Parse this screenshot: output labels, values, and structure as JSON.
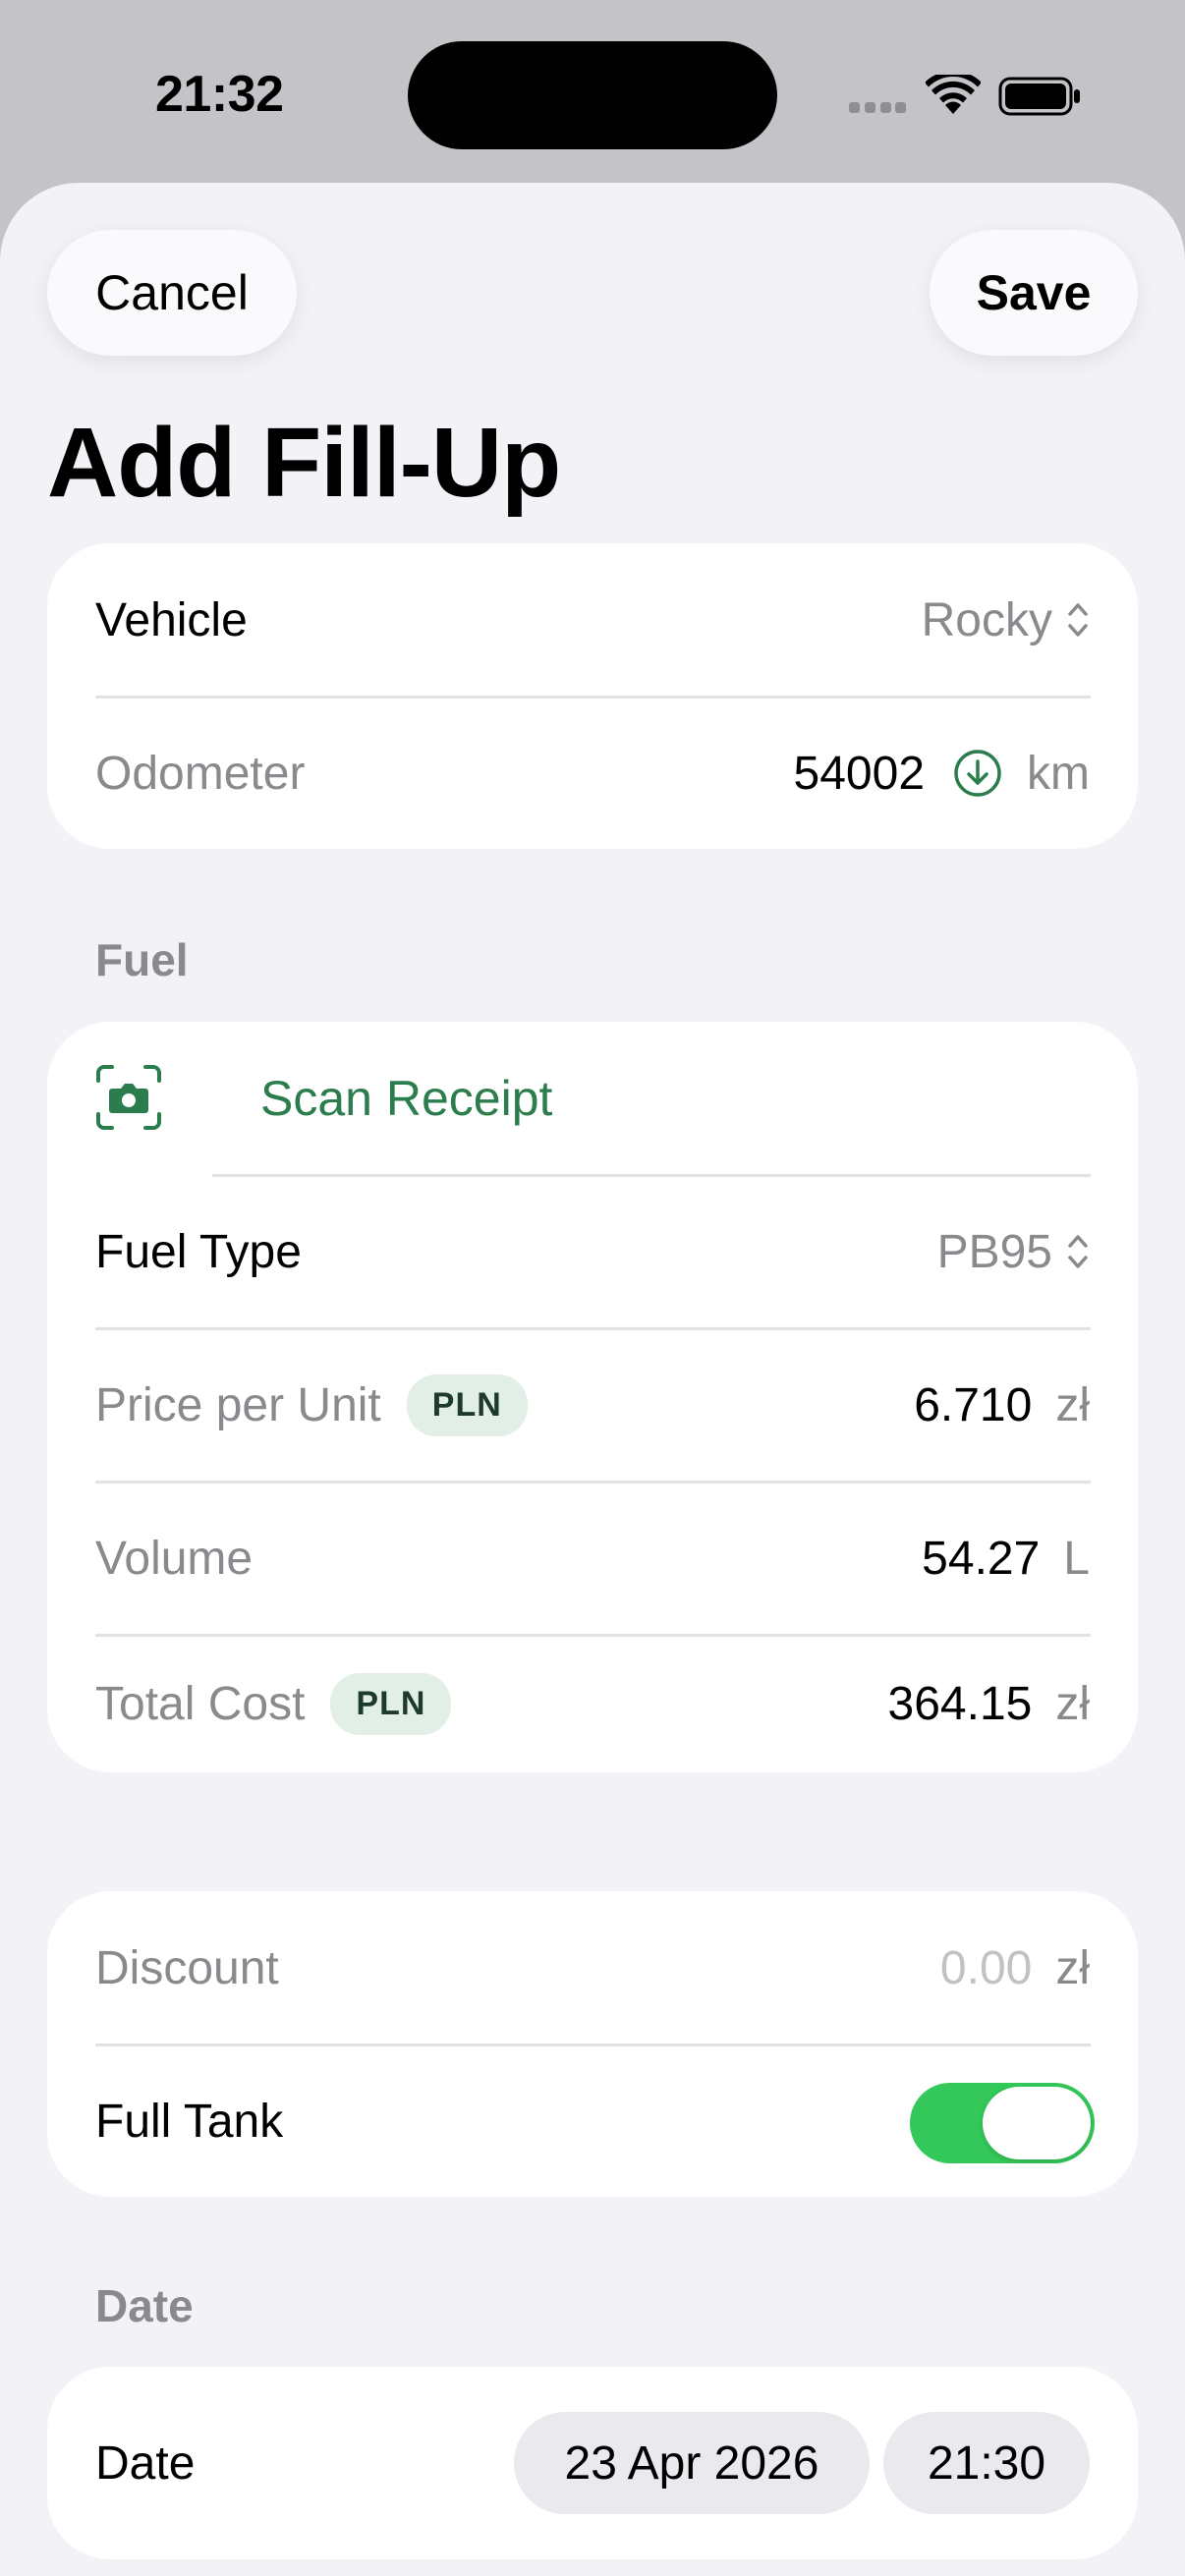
{
  "status_bar": {
    "time": "21:32"
  },
  "nav": {
    "cancel": "Cancel",
    "save": "Save",
    "title": "Add Fill-Up"
  },
  "vehicle_card": {
    "vehicle_label": "Vehicle",
    "vehicle_value": "Rocky",
    "odometer_label": "Odometer",
    "odometer_value": "54002",
    "odometer_unit": "km"
  },
  "fuel_section": {
    "header": "Fuel",
    "scan_receipt": "Scan Receipt",
    "fuel_type_label": "Fuel Type",
    "fuel_type_value": "PB95",
    "price_label": "Price per Unit",
    "price_badge": "PLN",
    "price_value": "6.710",
    "price_unit": "zł",
    "volume_label": "Volume",
    "volume_value": "54.27",
    "volume_unit": "L",
    "total_label": "Total Cost",
    "total_badge": "PLN",
    "total_value": "364.15",
    "total_unit": "zł"
  },
  "extras_card": {
    "discount_label": "Discount",
    "discount_placeholder": "0.00",
    "discount_unit": "zł",
    "full_tank_label": "Full Tank",
    "full_tank_on": true
  },
  "date_section": {
    "header": "Date",
    "date_label": "Date",
    "date_value": "23 Apr 2026",
    "time_value": "21:30"
  },
  "colors": {
    "accent_green": "#2b7d4d",
    "toggle_green": "#34c759",
    "background": "#f2f2f7"
  },
  "icons": [
    "wifi-icon",
    "battery-icon",
    "chevron-up-down-icon",
    "download-circle-icon",
    "camera-scan-icon"
  ]
}
